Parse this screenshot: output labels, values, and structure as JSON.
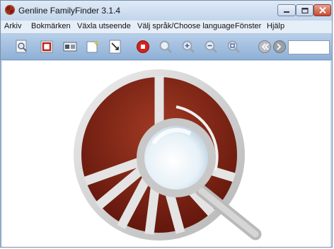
{
  "window": {
    "title": "Genline FamilyFinder 3.1.4",
    "controls": [
      "minimize",
      "maximize",
      "close"
    ]
  },
  "menubar": {
    "items": [
      {
        "label": "Arkiv"
      },
      {
        "label": "Bokmärken"
      },
      {
        "label": "Växla utseende"
      },
      {
        "label": "Välj språk/Choose language"
      },
      {
        "label": "Fönster"
      },
      {
        "label": "Hjälp"
      }
    ]
  },
  "toolbar": {
    "buttons": [
      {
        "icon": "zoom-page-icon"
      },
      {
        "icon": "red-frame-icon"
      },
      {
        "icon": "film-strip-icon"
      },
      {
        "icon": "sparkle-page-icon"
      },
      {
        "icon": "document-arrow-icon"
      },
      {
        "icon": "stop-icon"
      },
      {
        "icon": "zoom-magnifier-icon"
      },
      {
        "icon": "zoom-in-icon"
      },
      {
        "icon": "zoom-out-icon"
      },
      {
        "icon": "zoom-fit-icon"
      },
      {
        "icon": "back-arrow-icon"
      },
      {
        "icon": "forward-arrow-icon"
      }
    ],
    "search_value": ""
  },
  "colors": {
    "titlebar": "#c2d5ec",
    "toolbar": "#a3c0e0",
    "logo_brown": "#7a1f10",
    "logo_silver": "#d7d7d7",
    "close_red": "#c74a33"
  }
}
